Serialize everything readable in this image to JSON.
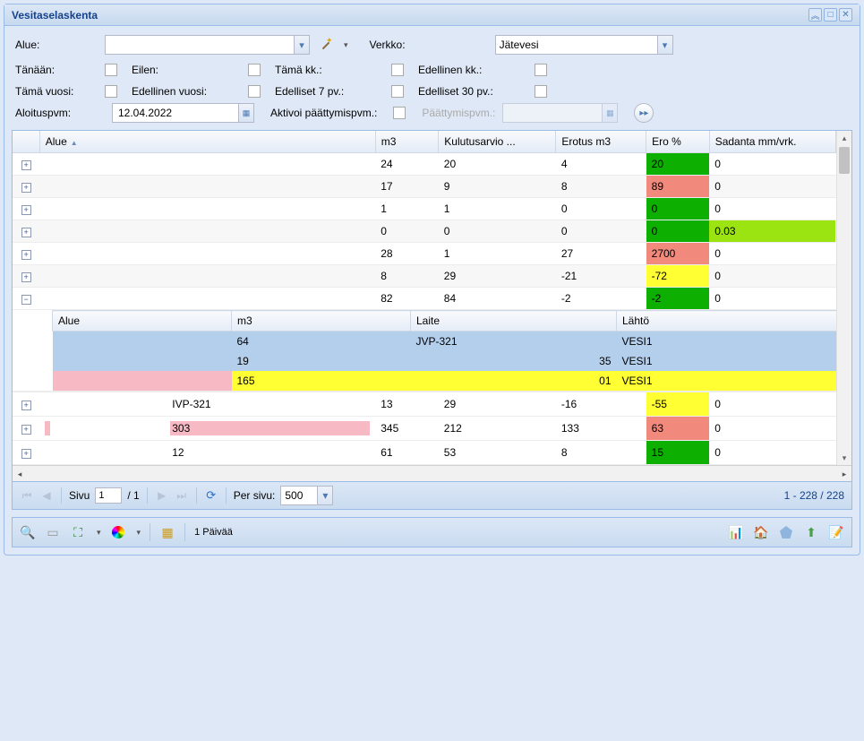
{
  "window": {
    "title": "Vesitaselaskenta"
  },
  "form": {
    "alue_label": "Alue:",
    "alue_value": "",
    "verkko_label": "Verkko:",
    "verkko_value": "Jätevesi",
    "checks": {
      "tanaan": "Tänään:",
      "eilen": "Eilen:",
      "tamakk": "Tämä kk.:",
      "edellinenkk": "Edellinen kk.:",
      "tamavuosi": "Tämä vuosi:",
      "edellinenvuosi": "Edellinen vuosi:",
      "edelliset7": "Edelliset 7 pv.:",
      "edelliset30": "Edelliset 30 pv.:"
    },
    "aloituspvm_label": "Aloituspvm:",
    "aloituspvm_value": "12.04.2022",
    "aktivoi_label": "Aktivoi päättymispvm.:",
    "paattymispvm_label": "Päättymispvm.:",
    "paattymispvm_value": ""
  },
  "columns": {
    "expand": "",
    "alue": "Alue",
    "m3": "m3",
    "kulutus": "Kulutusarvio ...",
    "erotus": "Erotus m3",
    "ero": "Ero %",
    "sadanta": "Sadanta mm/vrk."
  },
  "rows": [
    {
      "alue": "",
      "m3": "24",
      "kulutus": "20",
      "erotus": "4",
      "ero": "20",
      "erocss": "c-green",
      "sad": "0",
      "sadcss": ""
    },
    {
      "alue": "",
      "m3": "17",
      "kulutus": "9",
      "erotus": "8",
      "ero": "89",
      "erocss": "c-red",
      "sad": "0",
      "sadcss": ""
    },
    {
      "alue": "",
      "m3": "1",
      "kulutus": "1",
      "erotus": "0",
      "ero": "0",
      "erocss": "c-green",
      "sad": "0",
      "sadcss": ""
    },
    {
      "alue": "",
      "m3": "0",
      "kulutus": "0",
      "erotus": "0",
      "ero": "0",
      "erocss": "c-green",
      "sad": "0.03",
      "sadcss": "c-lime"
    },
    {
      "alue": "",
      "m3": "28",
      "kulutus": "1",
      "erotus": "27",
      "ero": "2700",
      "erocss": "c-red",
      "sad": "0",
      "sadcss": ""
    },
    {
      "alue": "",
      "m3": "8",
      "kulutus": "29",
      "erotus": "-21",
      "ero": "-72",
      "erocss": "c-yellow",
      "sad": "0",
      "sadcss": ""
    },
    {
      "alue": "",
      "m3": "82",
      "kulutus": "84",
      "erotus": "-2",
      "ero": "-2",
      "erocss": "c-green",
      "sad": "0",
      "sadcss": "",
      "expanded": true
    }
  ],
  "nested": {
    "header": {
      "alue": "Alue",
      "m3": "m3",
      "laite": "Laite",
      "lahto": "Lähtö"
    },
    "rows": [
      {
        "alue": "",
        "m3": "64",
        "laite": "JVP-321",
        "lahto": "VESI1",
        "rowcss": "c-blue",
        "aluecss": ""
      },
      {
        "alue": "",
        "m3": "19",
        "laite": "35",
        "lahto": "VESI1",
        "rowcss": "c-blue",
        "aluecss": ""
      },
      {
        "alue": "",
        "m3": "165",
        "laite": "01",
        "lahto": "VESI1",
        "rowcss": "c-yellow",
        "aluecss": "c-pink"
      }
    ]
  },
  "rows_after": [
    {
      "alue": "IVP-321",
      "aluecss": "",
      "m3": "13",
      "kulutus": "29",
      "erotus": "-16",
      "ero": "-55",
      "erocss": "c-yellow",
      "sad": "0"
    },
    {
      "alue": "303",
      "aluecss": "c-pink",
      "m3": "345",
      "kulutus": "212",
      "erotus": "133",
      "ero": "63",
      "erocss": "c-red",
      "sad": "0"
    },
    {
      "alue": "12",
      "aluecss": "",
      "m3": "61",
      "kulutus": "53",
      "erotus": "8",
      "ero": "15",
      "erocss": "c-green",
      "sad": "0"
    }
  ],
  "paging": {
    "sivu_label": "Sivu",
    "page": "1",
    "total_pages": "/ 1",
    "per_sivu_label": "Per sivu:",
    "per_sivu_value": "500",
    "display": "1 - 228 / 228"
  },
  "footer": {
    "days_label": "1 Päivää"
  }
}
